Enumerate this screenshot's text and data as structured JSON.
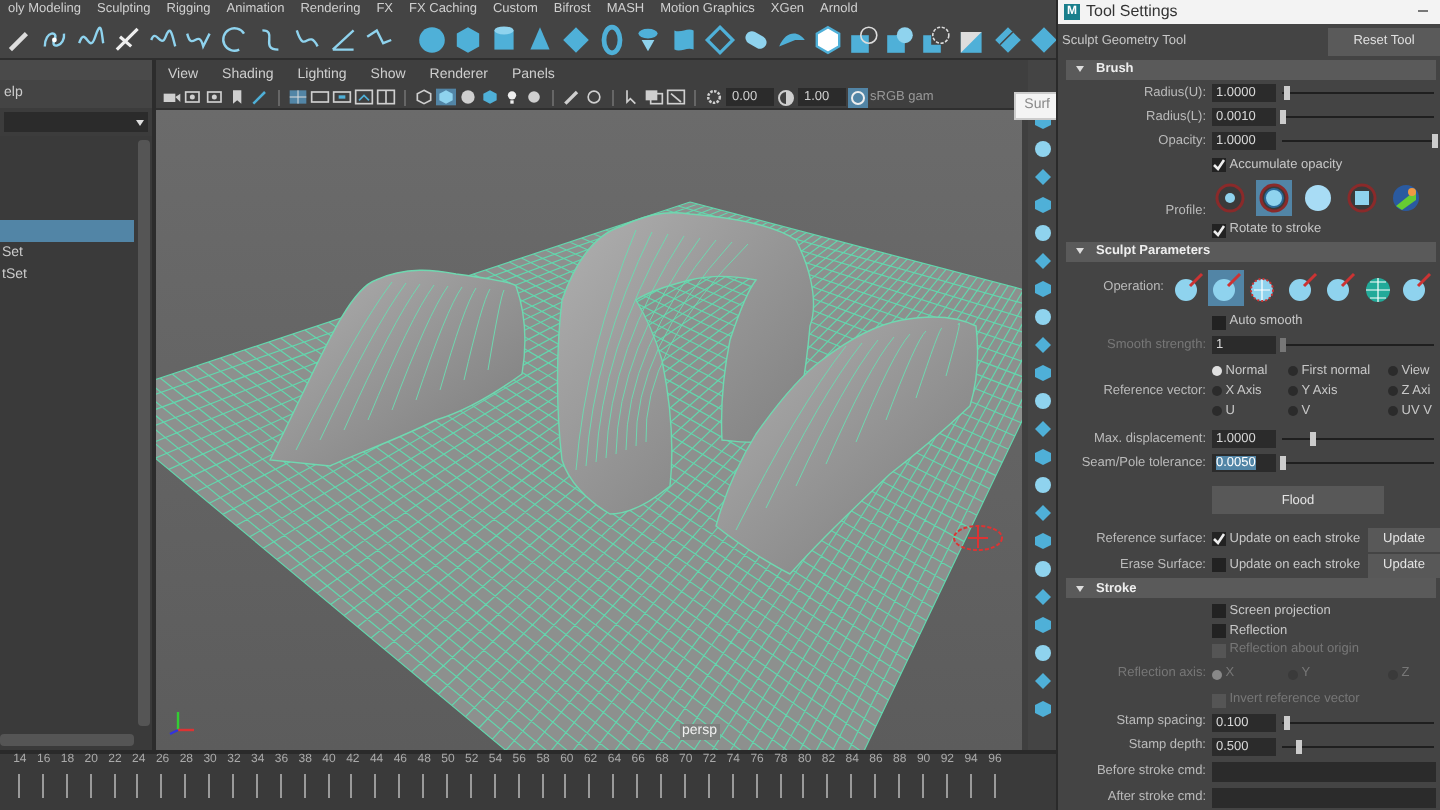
{
  "shelf_tabs": [
    "oly Modeling",
    "Sculpting",
    "Rigging",
    "Animation",
    "Rendering",
    "FX",
    "FX Caching",
    "Custom",
    "Bifrost",
    "MASH",
    "Motion Graphics",
    "XGen",
    "Arnold"
  ],
  "outliner": {
    "menu_label": "elp",
    "rows": [
      {
        "selected": true
      },
      {
        "label": "Set",
        "selected": false
      },
      {
        "label": "tSet",
        "selected": false
      }
    ]
  },
  "viewport": {
    "menus": [
      "View",
      "Shading",
      "Lighting",
      "Show",
      "Renderer",
      "Panels"
    ],
    "exposure": "0.00",
    "gamma": "1.00",
    "color_space": "sRGB gam",
    "popup_text": "Surf",
    "camera_label": "persp"
  },
  "timeline": {
    "frames": [
      "14",
      "16",
      "18",
      "20",
      "22",
      "24",
      "26",
      "28",
      "30",
      "32",
      "34",
      "36",
      "38",
      "40",
      "42",
      "44",
      "46",
      "48",
      "50",
      "52",
      "54",
      "56",
      "58",
      "60",
      "62",
      "64",
      "66",
      "68",
      "70",
      "72",
      "74",
      "76",
      "78",
      "80",
      "82",
      "84",
      "86",
      "88",
      "90",
      "92",
      "94",
      "96"
    ]
  },
  "tool_settings": {
    "logo": "M",
    "title": "Tool Settings",
    "tool_name": "Sculpt Geometry Tool",
    "reset_button": "Reset Tool",
    "sections": [
      {
        "title": "Brush",
        "expanded": true,
        "rows": [
          {
            "kind": "slider",
            "label": "Radius(U):",
            "value": "1.0000",
            "level": 0.03,
            "disabled": false,
            "value_selected": false
          },
          {
            "kind": "slider",
            "label": "Radius(L):",
            "value": "0.0010",
            "level": 0,
            "disabled": false,
            "value_selected": false
          },
          {
            "kind": "slider",
            "label": "Opacity:",
            "value": "1.0000",
            "level": 1,
            "disabled": false,
            "value_selected": false
          },
          {
            "kind": "checkbox",
            "label": "Accumulate opacity",
            "checked": true,
            "disabled": false
          },
          {
            "kind": "icon_choice",
            "label": "Profile:",
            "options": [
              {
                "kind": "dot",
                "selected": false
              },
              {
                "kind": "ring",
                "selected": true
              },
              {
                "kind": "disc",
                "selected": false
              },
              {
                "kind": "square",
                "selected": false
              },
              {
                "kind": "texture",
                "selected": false
              }
            ]
          },
          {
            "kind": "checkbox",
            "label": "Rotate to stroke",
            "checked": true,
            "disabled": false
          }
        ]
      },
      {
        "title": "Sculpt Parameters",
        "expanded": true,
        "rows": [
          {
            "kind": "icon_choice",
            "label": "Operation:",
            "options": [
              {
                "kind": "sphere",
                "selected": false
              },
              {
                "kind": "sphere",
                "selected": true
              },
              {
                "kind": "lattice",
                "selected": false
              },
              {
                "kind": "sphere",
                "selected": false
              },
              {
                "kind": "sphere",
                "selected": false
              },
              {
                "kind": "globe",
                "selected": false
              },
              {
                "kind": "sphere",
                "selected": false
              }
            ]
          },
          {
            "kind": "checkbox",
            "label": "Auto smooth",
            "checked": false,
            "disabled": false
          },
          {
            "kind": "slider",
            "label": "Smooth strength:",
            "value": "1",
            "level": 0,
            "disabled": true,
            "value_selected": false
          },
          {
            "kind": "radio_grid",
            "label": "Reference vector:",
            "disabled": false,
            "options": [
              {
                "label": "Normal",
                "selected": true
              },
              {
                "label": "First normal",
                "selected": false
              },
              {
                "label": "View",
                "selected": false
              },
              {
                "label": "X Axis",
                "selected": false
              },
              {
                "label": "Y Axis",
                "selected": false
              },
              {
                "label": "Z Axi",
                "selected": false
              },
              {
                "label": "U",
                "selected": false
              },
              {
                "label": "V",
                "selected": false
              },
              {
                "label": "UV V",
                "selected": false
              }
            ]
          },
          {
            "kind": "slider",
            "label": "Max. displacement:",
            "value": "1.0000",
            "level": 0.2,
            "disabled": false,
            "value_selected": false
          },
          {
            "kind": "slider",
            "label": "Seam/Pole tolerance:",
            "value": "0.0050",
            "level": 0,
            "disabled": false,
            "value_selected": true
          },
          {
            "kind": "button",
            "label": "Flood"
          },
          {
            "kind": "check_button",
            "label": "Reference surface:",
            "text": "Update on each stroke",
            "checked": true,
            "button": "Update"
          },
          {
            "kind": "check_button",
            "label": "Erase Surface:",
            "text": "Update on each stroke",
            "checked": false,
            "button": "Update"
          }
        ]
      },
      {
        "title": "Stroke",
        "expanded": true,
        "rows": [
          {
            "kind": "checkbox",
            "label": "Screen projection",
            "checked": false,
            "disabled": false
          },
          {
            "kind": "checkbox",
            "label": "Reflection",
            "checked": false,
            "disabled": false
          },
          {
            "kind": "checkbox",
            "label": "Reflection about origin",
            "checked": false,
            "disabled": true
          },
          {
            "kind": "radio_grid",
            "label": "Reflection axis:",
            "disabled": true,
            "options": [
              {
                "label": "X",
                "selected": true
              },
              {
                "label": "Y",
                "selected": false
              },
              {
                "label": "Z",
                "selected": false
              }
            ]
          },
          {
            "kind": "checkbox",
            "label": "Invert reference vector",
            "checked": false,
            "disabled": true
          },
          {
            "kind": "slider",
            "label": "Stamp spacing:",
            "value": "0.100",
            "level": 0.03,
            "disabled": false,
            "value_selected": false
          },
          {
            "kind": "slider",
            "label": "Stamp depth:",
            "value": "0.500",
            "level": 0.1,
            "disabled": false,
            "value_selected": false
          },
          {
            "kind": "text_field",
            "label": "Before stroke cmd:"
          },
          {
            "kind": "text_field",
            "label": "After stroke cmd:"
          }
        ]
      }
    ]
  }
}
